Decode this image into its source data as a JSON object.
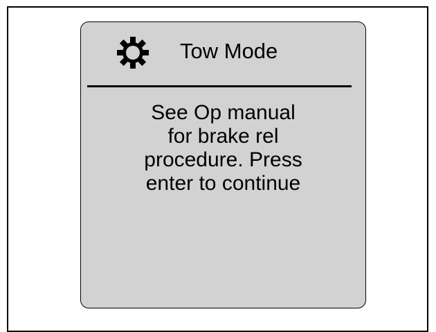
{
  "screen": {
    "icon": "gear-icon",
    "title": "Tow Mode",
    "message_lines": [
      "See Op manual",
      "for brake rel",
      "procedure. Press",
      "enter to continue"
    ]
  },
  "colors": {
    "screen_background": "#d2d2d2",
    "text": "#000000"
  }
}
